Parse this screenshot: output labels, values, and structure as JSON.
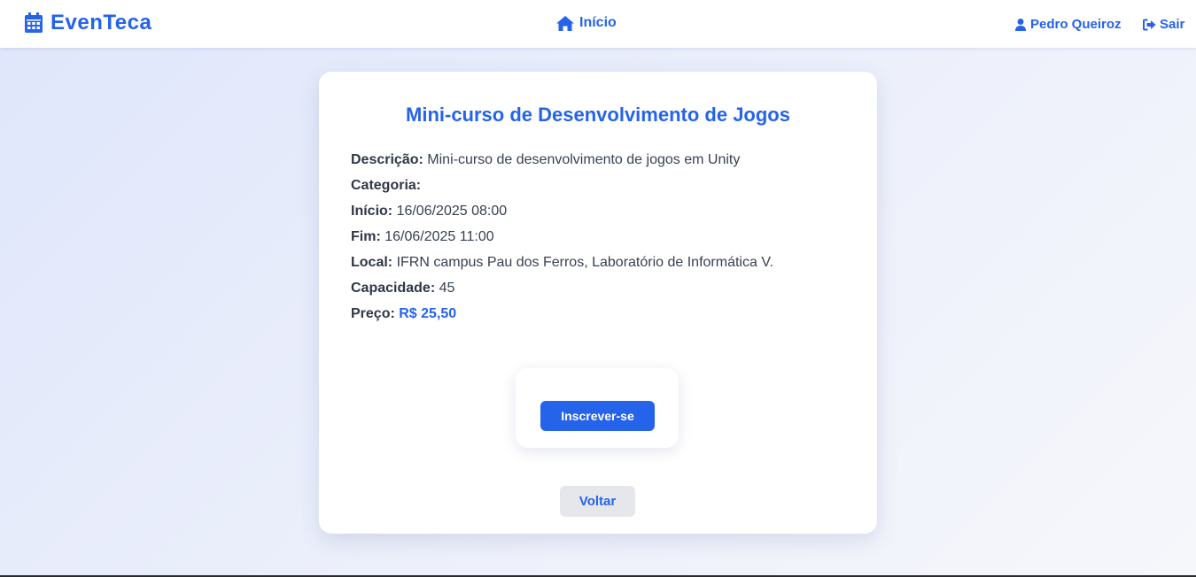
{
  "nav": {
    "brand": "EvenTeca",
    "brand_icon": "calendar-icon",
    "home_label": "Início",
    "home_icon": "home-icon",
    "user_name": "Pedro Queiroz",
    "user_icon": "user-icon",
    "logout_label": "Sair",
    "logout_icon": "sign-out-icon"
  },
  "event": {
    "title": "Mini-curso de Desenvolvimento de Jogos",
    "fields": {
      "description_label": "Descrição:",
      "description_value": "Mini-curso de desenvolvimento de jogos em Unity",
      "category_label": "Categoria:",
      "category_value": "",
      "start_label": "Início:",
      "start_value": "16/06/2025 08:00",
      "end_label": "Fim:",
      "end_value": "16/06/2025 11:00",
      "location_label": "Local:",
      "location_value": "IFRN campus Pau dos Ferros, Laboratório de Informática V.",
      "capacity_label": "Capacidade:",
      "capacity_value": "45",
      "price_label": "Preço:",
      "price_value": "R$ 25,50"
    }
  },
  "actions": {
    "subscribe_label": "Inscrever-se",
    "back_label": "Voltar"
  },
  "colors": {
    "accent": "#2563eb",
    "text": "#374151",
    "back_button_bg": "#e5e7eb"
  }
}
